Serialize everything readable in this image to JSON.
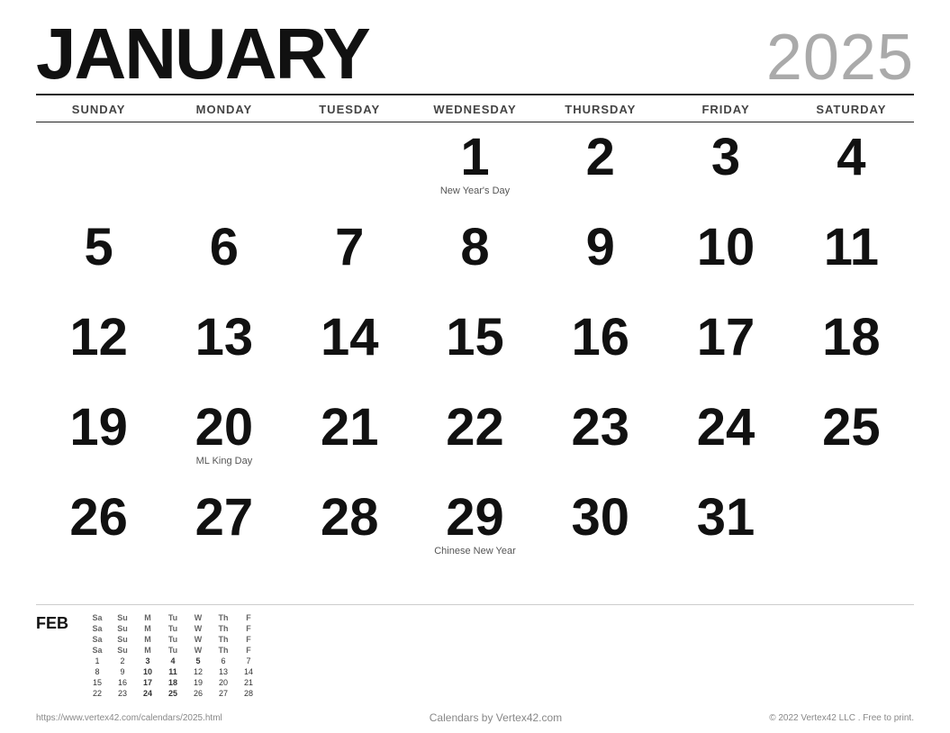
{
  "header": {
    "month": "JANUARY",
    "year": "2025"
  },
  "day_headers": [
    "SUNDAY",
    "MONDAY",
    "TUESDAY",
    "WEDNESDAY",
    "THURSDAY",
    "FRIDAY",
    "SATURDAY"
  ],
  "weeks": [
    [
      {
        "date": "",
        "event": ""
      },
      {
        "date": "",
        "event": ""
      },
      {
        "date": "",
        "event": ""
      },
      {
        "date": "1",
        "event": "New Year's Day"
      },
      {
        "date": "2",
        "event": ""
      },
      {
        "date": "3",
        "event": ""
      },
      {
        "date": "4",
        "event": ""
      }
    ],
    [
      {
        "date": "5",
        "event": ""
      },
      {
        "date": "6",
        "event": ""
      },
      {
        "date": "7",
        "event": ""
      },
      {
        "date": "8",
        "event": ""
      },
      {
        "date": "9",
        "event": ""
      },
      {
        "date": "10",
        "event": ""
      },
      {
        "date": "11",
        "event": ""
      }
    ],
    [
      {
        "date": "12",
        "event": ""
      },
      {
        "date": "13",
        "event": ""
      },
      {
        "date": "14",
        "event": ""
      },
      {
        "date": "15",
        "event": ""
      },
      {
        "date": "16",
        "event": ""
      },
      {
        "date": "17",
        "event": ""
      },
      {
        "date": "18",
        "event": ""
      }
    ],
    [
      {
        "date": "19",
        "event": ""
      },
      {
        "date": "20",
        "event": "ML King Day"
      },
      {
        "date": "21",
        "event": ""
      },
      {
        "date": "22",
        "event": ""
      },
      {
        "date": "23",
        "event": ""
      },
      {
        "date": "24",
        "event": ""
      },
      {
        "date": "25",
        "event": ""
      }
    ],
    [
      {
        "date": "26",
        "event": ""
      },
      {
        "date": "27",
        "event": ""
      },
      {
        "date": "28",
        "event": ""
      },
      {
        "date": "29",
        "event": "Chinese New Year"
      },
      {
        "date": "30",
        "event": ""
      },
      {
        "date": "31",
        "event": ""
      },
      {
        "date": "",
        "event": ""
      }
    ]
  ],
  "mini": {
    "label": "FEB",
    "headers": [
      "Sa",
      "Su",
      "M",
      "Tu",
      "W",
      "Th",
      "F",
      "Sa",
      "Su",
      "M",
      "Tu",
      "W",
      "Th",
      "F",
      "Sa",
      "Su",
      "M",
      "Tu",
      "W",
      "Th",
      "F",
      "Sa",
      "Su",
      "M",
      "Tu",
      "W",
      "Th",
      "F"
    ],
    "days": [
      "1",
      "2",
      "3",
      "4",
      "5",
      "6",
      "7",
      "8",
      "9",
      "10",
      "11",
      "12",
      "13",
      "14",
      "15",
      "16",
      "17",
      "18",
      "19",
      "20",
      "21",
      "22",
      "23",
      "24",
      "25",
      "26",
      "27",
      "28"
    ],
    "bold_days": [
      "3",
      "4",
      "5",
      "10",
      "11",
      "17",
      "18",
      "24",
      "25"
    ]
  },
  "footer": {
    "url": "https://www.vertex42.com/calendars/2025.html",
    "center": "Calendars by Vertex42.com",
    "copyright": "© 2022 Vertex42 LLC . Free to print."
  }
}
